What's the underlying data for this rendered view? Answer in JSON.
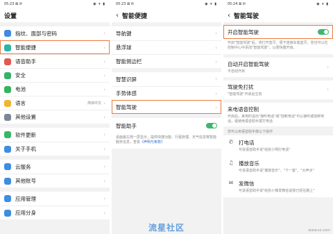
{
  "panel1": {
    "status_time": "05:23 ⊠ ✉",
    "status_icons": "◉ ▾ ▮",
    "title": "设置",
    "groups": [
      [
        {
          "label": "指纹、面部与密码",
          "icon": "fingerprint-icon",
          "color": "#3f8be0"
        },
        {
          "label": "智能便捷",
          "icon": "smart-icon",
          "color": "#2fb3a4",
          "highlight": true
        },
        {
          "label": "语音助手",
          "icon": "voice-icon",
          "color": "#e4584f"
        },
        {
          "label": "安全",
          "icon": "security-icon",
          "color": "#37b26c"
        },
        {
          "label": "电池",
          "icon": "battery-icon",
          "color": "#35b45e"
        },
        {
          "label": "语言",
          "icon": "language-icon",
          "color": "#f2b330",
          "value": "简体中文"
        },
        {
          "label": "其他设置",
          "icon": "more-settings-icon",
          "color": "#7a8796"
        }
      ],
      [
        {
          "label": "软件更新",
          "icon": "update-icon",
          "color": "#39b667"
        },
        {
          "label": "关于手机",
          "icon": "about-icon",
          "color": "#3d8ee0"
        }
      ],
      [
        {
          "label": "云服务",
          "icon": "cloud-icon",
          "color": "#3d8ee0"
        },
        {
          "label": "其他账号",
          "icon": "account-icon",
          "color": "#3d8ee0"
        }
      ],
      [
        {
          "label": "应用管理",
          "icon": "app-manage-icon",
          "color": "#3d8ee0"
        },
        {
          "label": "应用分身",
          "icon": "app-clone-icon",
          "color": "#3d8ee0"
        }
      ]
    ]
  },
  "panel2": {
    "status_time": "05:23 ⊠ ✉",
    "status_icons": "◉ ▾ ▮",
    "title": "智能便捷",
    "groups": [
      [
        {
          "label": "导航键"
        },
        {
          "label": "悬浮球"
        },
        {
          "label": "智能侧边栏"
        }
      ],
      [
        {
          "label": "智慧识屏"
        },
        {
          "label": "手势体感"
        },
        {
          "label": "智能驾驶",
          "highlight": true
        }
      ]
    ],
    "toggle_label": "智能助手",
    "toggle_desc": "桌面最左侧一屏显示，提供快捷功能、行程管理、天气信息等智能服务信息，查看",
    "toggle_desc_link": "《声明与条款》"
  },
  "panel3": {
    "status_time": "05:24 ⊠ ✉",
    "status_icons": "◉ ▾ ▮",
    "title": "智能驾驶",
    "main_toggle_label": "开启智能驾驶",
    "main_desc": "开启\"智能驾驶\"后，将打开蓝牙，便于连接车载蓝牙。您也可以在控制中心中添加\"智能驾驶\"，以便快捷开启。",
    "auto_title": "自动开启智能驾驶",
    "auto_sub": "不自动开启",
    "dnd_title": "驾驶免打扰",
    "dnd_sub": "\"智能驾驶\"开启后生效",
    "voice_title": "来电语音控制",
    "voice_sub": "开启后，来电时说出\"接听电话\"或\"挂断电话\"可以接听或挂断电话，或使用语音助手拨打电话",
    "hint": "您可以用语音助手做以下操作",
    "commands": [
      {
        "title": "打电话",
        "sub": "可说语音助手说\"给张小明打电话\"",
        "icon": "phone-icon",
        "glyph": "✆"
      },
      {
        "title": "播放音乐",
        "sub": "可说语音助手说\"播放音乐\"、\"下一首\"、\"大声点\"",
        "icon": "music-icon",
        "glyph": "♫"
      },
      {
        "title": "发微信",
        "sub": "可说语音助手说\"给张小微发微信说我已经在路上\"",
        "icon": "wechat-icon",
        "glyph": "✉"
      }
    ]
  },
  "watermark": "流星社区",
  "watermark2": "www.xx.com"
}
